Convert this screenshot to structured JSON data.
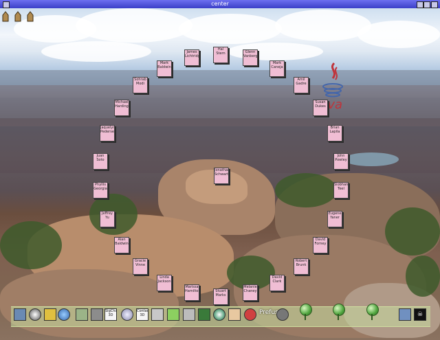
{
  "window": {
    "title": "center"
  },
  "people": [
    {
      "first": "Hal",
      "last": "Stern"
    },
    {
      "first": "James",
      "last": "Lichtridge"
    },
    {
      "first": "Glenn",
      "last": "Vanberg"
    },
    {
      "first": "Mark",
      "last": "Baldwin"
    },
    {
      "first": "Mark",
      "last": "Caneja"
    },
    {
      "first": "Sohrab",
      "last": "Modi"
    },
    {
      "first": "Amil",
      "last": "Gadre"
    },
    {
      "first": "Michael",
      "last": "Harding"
    },
    {
      "first": "Susan",
      "last": "Dukes"
    },
    {
      "first": "Brian",
      "last": "Lapila"
    },
    {
      "first": "Jaquelyn",
      "last": "Pedersen"
    },
    {
      "first": "John",
      "last": "Powley"
    },
    {
      "first": "Juan",
      "last": "Soto"
    },
    {
      "first": "Jonathan",
      "last": "Schwartz"
    },
    {
      "first": "Phyllis",
      "last": "Georgia"
    },
    {
      "first": "Siobhan",
      "last": "Teel"
    },
    {
      "first": "Jeffrey",
      "last": "Yu"
    },
    {
      "first": "Eugene",
      "last": "Yaner"
    },
    {
      "first": "Alan",
      "last": "Baldwin"
    },
    {
      "first": "David",
      "last": "Forney"
    },
    {
      "first": "Gracie",
      "last": "Vinne"
    },
    {
      "first": "Robert",
      "last": "Brunk"
    },
    {
      "first": "Linda",
      "last": "Jackson"
    },
    {
      "first": "David",
      "last": "Clark"
    },
    {
      "first": "Marissa",
      "last": "Hamilton"
    },
    {
      "first": "Melanie",
      "last": "Chaney"
    },
    {
      "first": "Stuart",
      "last": "Marks"
    }
  ],
  "logo": {
    "text": "Java",
    "icon": "java-coffee-cup-icon"
  },
  "toolbar": {
    "labels": {
      "sigchart": "SigChart\n3D",
      "contact": "Contact\n3D",
      "prefuse": "Prefuse"
    },
    "icons": [
      "monitor-icon",
      "cd-icon",
      "help-icon",
      "globe-icon",
      "tree-icon",
      "gear-icon",
      "sigchart-icon",
      "disk-icon",
      "contact-icon",
      "airplane-icon",
      "map-icon",
      "magnifier-icon",
      "puzzle-icon",
      "dvd-icon",
      "face-icon",
      "molecule-icon",
      "prefuse-icon",
      "film-icon",
      "orb-icon",
      "star-icon",
      "pirate-flag-icon"
    ]
  },
  "colors": {
    "titlebar": "#4a4ed8",
    "person_card": "#f0bed4",
    "java_red": "#c0333a",
    "toolbar": "#c6dca0"
  }
}
